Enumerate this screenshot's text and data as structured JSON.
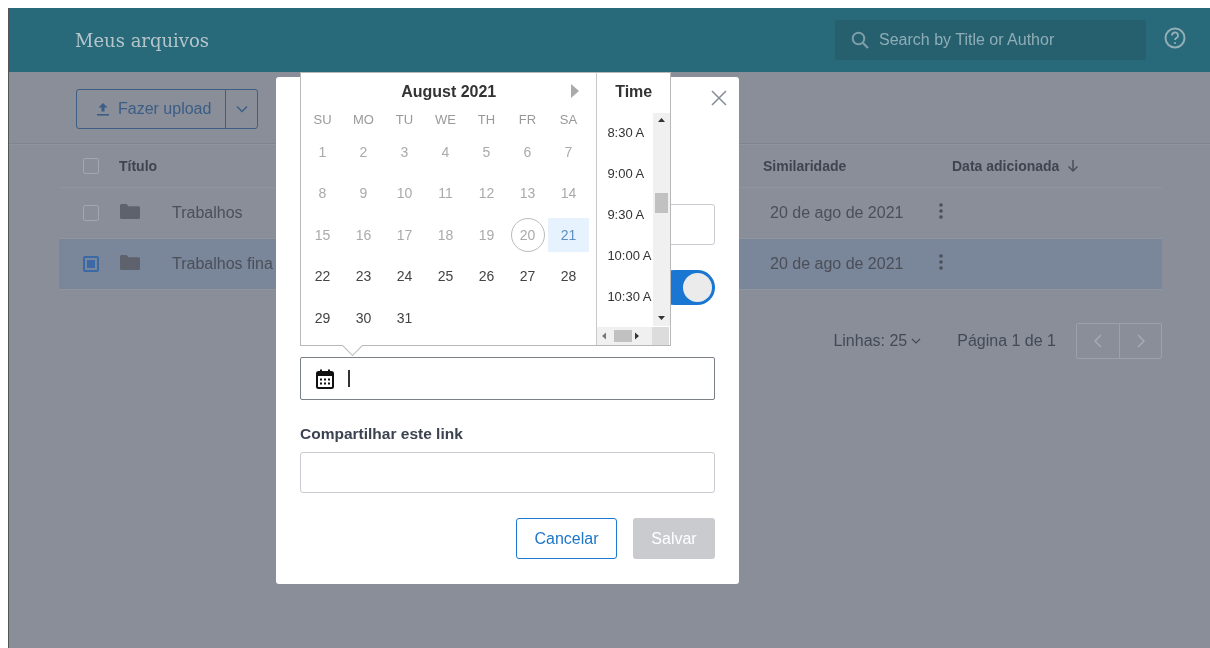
{
  "header": {
    "title": "Meus arquivos",
    "search": {
      "placeholder": "Search by Title or Author"
    }
  },
  "toolbar": {
    "upload_button": "Fazer upload"
  },
  "table": {
    "select_all": {
      "checked": false
    },
    "columns": [
      {
        "label": "Título",
        "sorted": false
      },
      {
        "label": "Similaridade",
        "sorted": false
      },
      {
        "label": "Data adicionada",
        "sorted": true
      }
    ],
    "rows": [
      {
        "title": "Trabalhos",
        "date": "20 de ago de 2021",
        "checked": false,
        "selected": false
      },
      {
        "title": "Trabalhos fina",
        "date": "20 de ago de 2021",
        "checked": true,
        "selected": true
      }
    ]
  },
  "pagination": {
    "rows_label": "Linhas: 25",
    "page_label": "Página 1 de 1"
  },
  "dialog": {
    "toggle": {
      "on": true
    },
    "share_label": "Compartilhar este link",
    "buttons": [
      {
        "label": "Cancelar",
        "kind": "secondary",
        "disabled": false
      },
      {
        "label": "Salvar",
        "kind": "primary",
        "disabled": true
      }
    ]
  },
  "date_picker": {
    "month": "August 2021",
    "weekdays": [
      "SU",
      "MO",
      "TU",
      "WE",
      "TH",
      "FR",
      "SA"
    ],
    "days": [
      {
        "label": "1",
        "disabled": true,
        "today": false,
        "selected": false
      },
      {
        "label": "2",
        "disabled": true,
        "today": false,
        "selected": false
      },
      {
        "label": "3",
        "disabled": true,
        "today": false,
        "selected": false
      },
      {
        "label": "4",
        "disabled": true,
        "today": false,
        "selected": false
      },
      {
        "label": "5",
        "disabled": true,
        "today": false,
        "selected": false
      },
      {
        "label": "6",
        "disabled": true,
        "today": false,
        "selected": false
      },
      {
        "label": "7",
        "disabled": true,
        "today": false,
        "selected": false
      },
      {
        "label": "8",
        "disabled": true,
        "today": false,
        "selected": false
      },
      {
        "label": "9",
        "disabled": true,
        "today": false,
        "selected": false
      },
      {
        "label": "10",
        "disabled": true,
        "today": false,
        "selected": false
      },
      {
        "label": "11",
        "disabled": true,
        "today": false,
        "selected": false
      },
      {
        "label": "12",
        "disabled": true,
        "today": false,
        "selected": false
      },
      {
        "label": "13",
        "disabled": true,
        "today": false,
        "selected": false
      },
      {
        "label": "14",
        "disabled": true,
        "today": false,
        "selected": false
      },
      {
        "label": "15",
        "disabled": true,
        "today": false,
        "selected": false
      },
      {
        "label": "16",
        "disabled": true,
        "today": false,
        "selected": false
      },
      {
        "label": "17",
        "disabled": true,
        "today": false,
        "selected": false
      },
      {
        "label": "18",
        "disabled": true,
        "today": false,
        "selected": false
      },
      {
        "label": "19",
        "disabled": true,
        "today": false,
        "selected": false
      },
      {
        "label": "20",
        "disabled": true,
        "today": true,
        "selected": false
      },
      {
        "label": "21",
        "disabled": true,
        "today": false,
        "selected": true
      },
      {
        "label": "22",
        "disabled": false,
        "today": false,
        "selected": false
      },
      {
        "label": "23",
        "disabled": false,
        "today": false,
        "selected": false
      },
      {
        "label": "24",
        "disabled": false,
        "today": false,
        "selected": false
      },
      {
        "label": "25",
        "disabled": false,
        "today": false,
        "selected": false
      },
      {
        "label": "26",
        "disabled": false,
        "today": false,
        "selected": false
      },
      {
        "label": "27",
        "disabled": false,
        "today": false,
        "selected": false
      },
      {
        "label": "28",
        "disabled": false,
        "today": false,
        "selected": false
      },
      {
        "label": "29",
        "disabled": false,
        "today": false,
        "selected": false
      },
      {
        "label": "30",
        "disabled": false,
        "today": false,
        "selected": false
      },
      {
        "label": "31",
        "disabled": false,
        "today": false,
        "selected": false
      }
    ],
    "time_title": "Time",
    "times": [
      "8:30 A",
      "9:00 A",
      "9:30 A",
      "10:00 A",
      "10:30 A"
    ]
  }
}
